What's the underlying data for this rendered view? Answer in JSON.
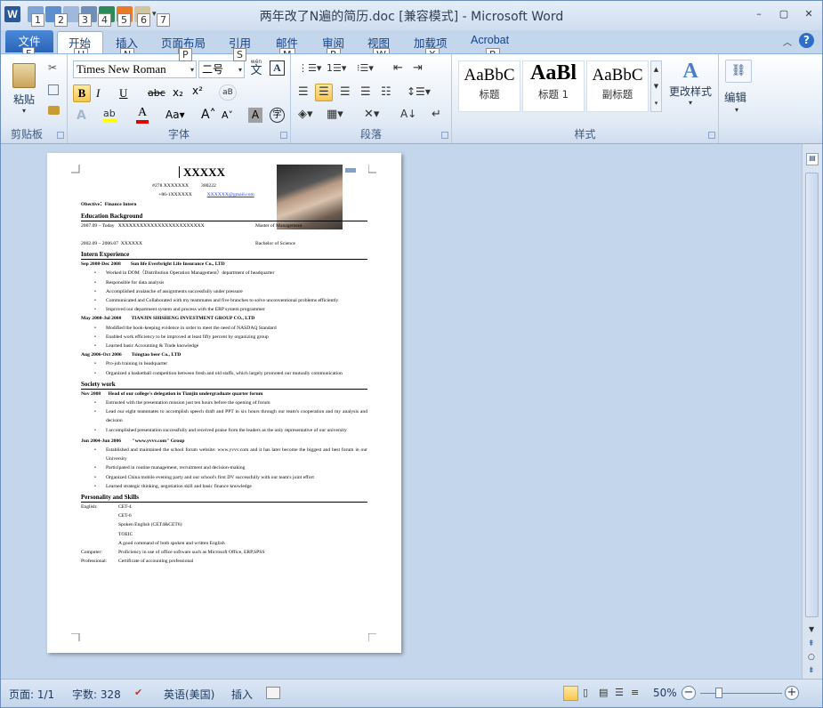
{
  "window": {
    "title": "两年改了N遍的简历.doc [兼容模式] - Microsoft Word",
    "min": "–",
    "max": "▢",
    "close": "✕"
  },
  "qat": {
    "keytips": [
      "1",
      "2",
      "3",
      "4",
      "5",
      "6",
      "7"
    ]
  },
  "tabs": {
    "file": "文件",
    "file_tip": "F",
    "items": [
      {
        "label": "开始",
        "tip": "H"
      },
      {
        "label": "插入",
        "tip": "N"
      },
      {
        "label": "页面布局",
        "tip": "P"
      },
      {
        "label": "引用",
        "tip": "S"
      },
      {
        "label": "邮件",
        "tip": "M"
      },
      {
        "label": "审阅",
        "tip": "R"
      },
      {
        "label": "视图",
        "tip": "W"
      },
      {
        "label": "加载项",
        "tip": "X"
      },
      {
        "label": "Acrobat",
        "tip": "B"
      }
    ]
  },
  "ribbon": {
    "clipboard": {
      "label": "剪贴板",
      "paste": "粘贴"
    },
    "font": {
      "label": "字体",
      "name": "Times New Roman",
      "size": "二号",
      "wen": "wén",
      "wen_char": "文",
      "A": "A"
    },
    "paragraph": {
      "label": "段落"
    },
    "styles": {
      "label": "样式",
      "items": [
        {
          "sample": "AaBbC",
          "name": "标题"
        },
        {
          "sample": "AaBl",
          "name": "标题 1"
        },
        {
          "sample": "AaBbC",
          "name": "副标题"
        }
      ],
      "change": "更改样式"
    },
    "editing": {
      "label": "编辑"
    }
  },
  "resume": {
    "name": "XXXXX",
    "addr": "#278 XXXXXXX          300222",
    "phone": "+86-1XXXXXX",
    "email": "XXXXXX@gmail.com",
    "objective": "Obective：Finance Intern",
    "edu_h": "Education Background",
    "edu1_l": "2007.09 – Today   XXXXXXXXXXXXXXXXXXXXXXXX",
    "edu1_r": "Master of Management",
    "edu2_l": "2002.09 – 2006.07  XXXXXX",
    "edu2_r": "Bachelor of Science",
    "intern_h": "Intern Experience",
    "j1": "Sep 2008-Dec 2008        Sun life Everbright Life Insurance Co., LTD",
    "j1b": [
      "Worked in DOM（Distribution Operation Management）department of headquarter",
      "Responsible for data analysis",
      "Accomplished avalanche of assignments successfully under pressure",
      "Communicated and Collaborated with my teammates and five branches to solve unconventional problems efficiently",
      "Improved our department system and process with the ERP system programmer"
    ],
    "j2": "May 2008-Jul 2008        TIANJIN SHISHENG INVESTMENT GROUP CO., LTD",
    "j2b": [
      "Modified the book-keeping evidence in order to meet the need of NASDAQ Standard",
      "Enabled work efficiency to be improved at least fifty percent by organizing group",
      "Learned basic Accounting & Trade knowledge"
    ],
    "j3": "Aug 2006-Oct 2006        Tsingtao beer Co., LTD",
    "j3b": [
      "Pro-job training in headquarter",
      "Organized a basketball competition between fresh and old staffs, which largely promoted our mutually communication"
    ],
    "soc_h": "Society work",
    "s1": "Nov 2008      Head of our college's delegation in Tianjin undergraduate quarter forum",
    "s1b": [
      "Entrusted with the presentation mission just ten hours before the opening of forum",
      "Lead our eight teammates to accomplish speech draft and PPT in six hours through our team's cooperation and my analysis and decision",
      "I accomplished presentation successfully and received praise from the leaders as the only representative of our university"
    ],
    "s2": "Jun 2004-Jun 2006         \"www.yvvv.com\" Group",
    "s2b": [
      "Established and maintained the school forum website: www.yvvv.com and it has later become the biggest and best forum in our University",
      "Participated in routine management, recruitment and decision-making",
      "Organized China mobile evening party and our school's first DV successfully with our team's joint effort",
      "Learned strategic thinking, negotiation skill and basic finance knowledge"
    ],
    "pers_h": "Personality and Skills",
    "english_k": "English:",
    "english_v": [
      "CET-4",
      "CET-6",
      "Spoken English (CET4&CET6)",
      "TOEIC",
      "A good command of both spoken and written English"
    ],
    "computer_k": "Computer:",
    "computer_v": "Proficiency in use of office software such as Microsoft Office, ERP,SPSS",
    "prof_k": "Professional:",
    "prof_v": "Certificate of accounting professional"
  },
  "status": {
    "page": "页面: 1/1",
    "words": "字数: 328",
    "lang": "英语(美国)",
    "mode": "插入",
    "zoom": "50%"
  }
}
